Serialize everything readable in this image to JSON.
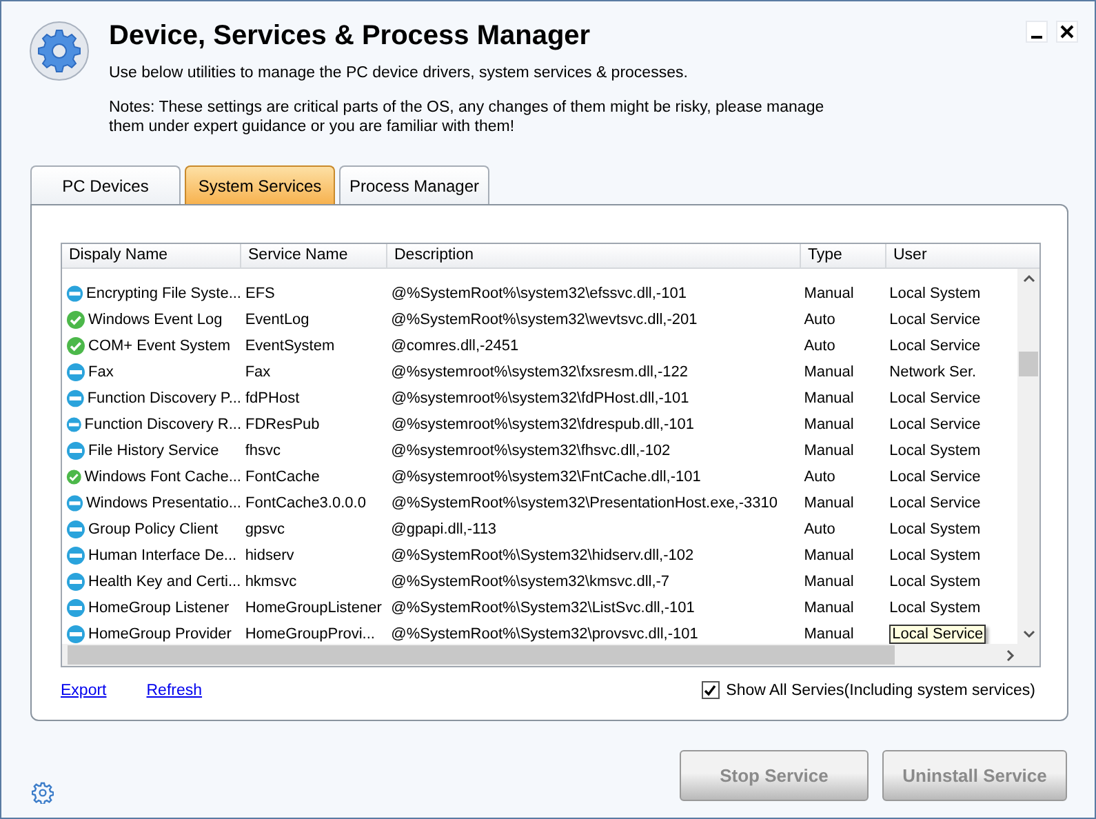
{
  "window": {
    "title": "Device, Services & Process Manager",
    "subtitle": "Use below utilities to manage the PC device drivers, system services & processes.",
    "notes": "Notes: These settings are critical parts of the OS, any changes of them might be risky, please manage them under expert guidance or you are familiar with them!"
  },
  "tabs": [
    {
      "label": "PC Devices",
      "selected": false
    },
    {
      "label": "System Services",
      "selected": true
    },
    {
      "label": "Process Manager",
      "selected": false
    }
  ],
  "table": {
    "columns": [
      "Dispaly Name",
      "Service Name",
      "Description",
      "Type",
      "User"
    ],
    "rows": [
      {
        "running": false,
        "name": "Encrypting File Syste...",
        "service": "EFS",
        "description": "@%SystemRoot%\\system32\\efssvc.dll,-101",
        "type": "Manual",
        "user": "Local System",
        "tooltip": false
      },
      {
        "running": true,
        "name": "Windows Event Log",
        "service": "EventLog",
        "description": "@%SystemRoot%\\system32\\wevtsvc.dll,-201",
        "type": "Auto",
        "user": "Local Service",
        "tooltip": false
      },
      {
        "running": true,
        "name": "COM+ Event System",
        "service": "EventSystem",
        "description": "@comres.dll,-2451",
        "type": "Auto",
        "user": "Local Service",
        "tooltip": false
      },
      {
        "running": false,
        "name": "Fax",
        "service": "Fax",
        "description": "@%systemroot%\\system32\\fxsresm.dll,-122",
        "type": "Manual",
        "user": "Network Ser.",
        "tooltip": false
      },
      {
        "running": false,
        "name": "Function Discovery P...",
        "service": "fdPHost",
        "description": "@%systemroot%\\system32\\fdPHost.dll,-101",
        "type": "Manual",
        "user": "Local Service",
        "tooltip": false
      },
      {
        "running": false,
        "name": "Function Discovery R...",
        "service": "FDResPub",
        "description": "@%systemroot%\\system32\\fdrespub.dll,-101",
        "type": "Manual",
        "user": "Local Service",
        "tooltip": false
      },
      {
        "running": false,
        "name": "File History Service",
        "service": "fhsvc",
        "description": "@%systemroot%\\system32\\fhsvc.dll,-102",
        "type": "Manual",
        "user": "Local System",
        "tooltip": false
      },
      {
        "running": true,
        "name": "Windows Font Cache...",
        "service": "FontCache",
        "description": "@%systemroot%\\system32\\FntCache.dll,-101",
        "type": "Auto",
        "user": "Local Service",
        "tooltip": false
      },
      {
        "running": false,
        "name": "Windows Presentatio...",
        "service": "FontCache3.0.0.0",
        "description": "@%SystemRoot%\\system32\\PresentationHost.exe,-3310",
        "type": "Manual",
        "user": "Local Service",
        "tooltip": false
      },
      {
        "running": false,
        "name": "Group Policy Client",
        "service": "gpsvc",
        "description": "@gpapi.dll,-113",
        "type": "Auto",
        "user": "Local System",
        "tooltip": false
      },
      {
        "running": false,
        "name": "Human Interface De...",
        "service": "hidserv",
        "description": "@%SystemRoot%\\System32\\hidserv.dll,-102",
        "type": "Manual",
        "user": "Local System",
        "tooltip": false
      },
      {
        "running": false,
        "name": "Health Key and Certi...",
        "service": "hkmsvc",
        "description": "@%SystemRoot%\\system32\\kmsvc.dll,-7",
        "type": "Manual",
        "user": "Local System",
        "tooltip": false
      },
      {
        "running": false,
        "name": "HomeGroup Listener",
        "service": "HomeGroupListener",
        "description": "@%SystemRoot%\\System32\\ListSvc.dll,-101",
        "type": "Manual",
        "user": "Local System",
        "tooltip": false
      },
      {
        "running": false,
        "name": "HomeGroup Provider",
        "service": "HomeGroupProvi...",
        "description": "@%SystemRoot%\\System32\\provsvc.dll,-101",
        "type": "Manual",
        "user": "Local Service",
        "tooltip": true
      }
    ]
  },
  "links": [
    "Export",
    "Refresh"
  ],
  "show_all": {
    "label": "Show All Servies(Including system services)",
    "checked": true
  },
  "buttons": [
    {
      "label": "Stop Service",
      "disabled": true
    },
    {
      "label": "Uninstall Service",
      "disabled": true
    }
  ]
}
